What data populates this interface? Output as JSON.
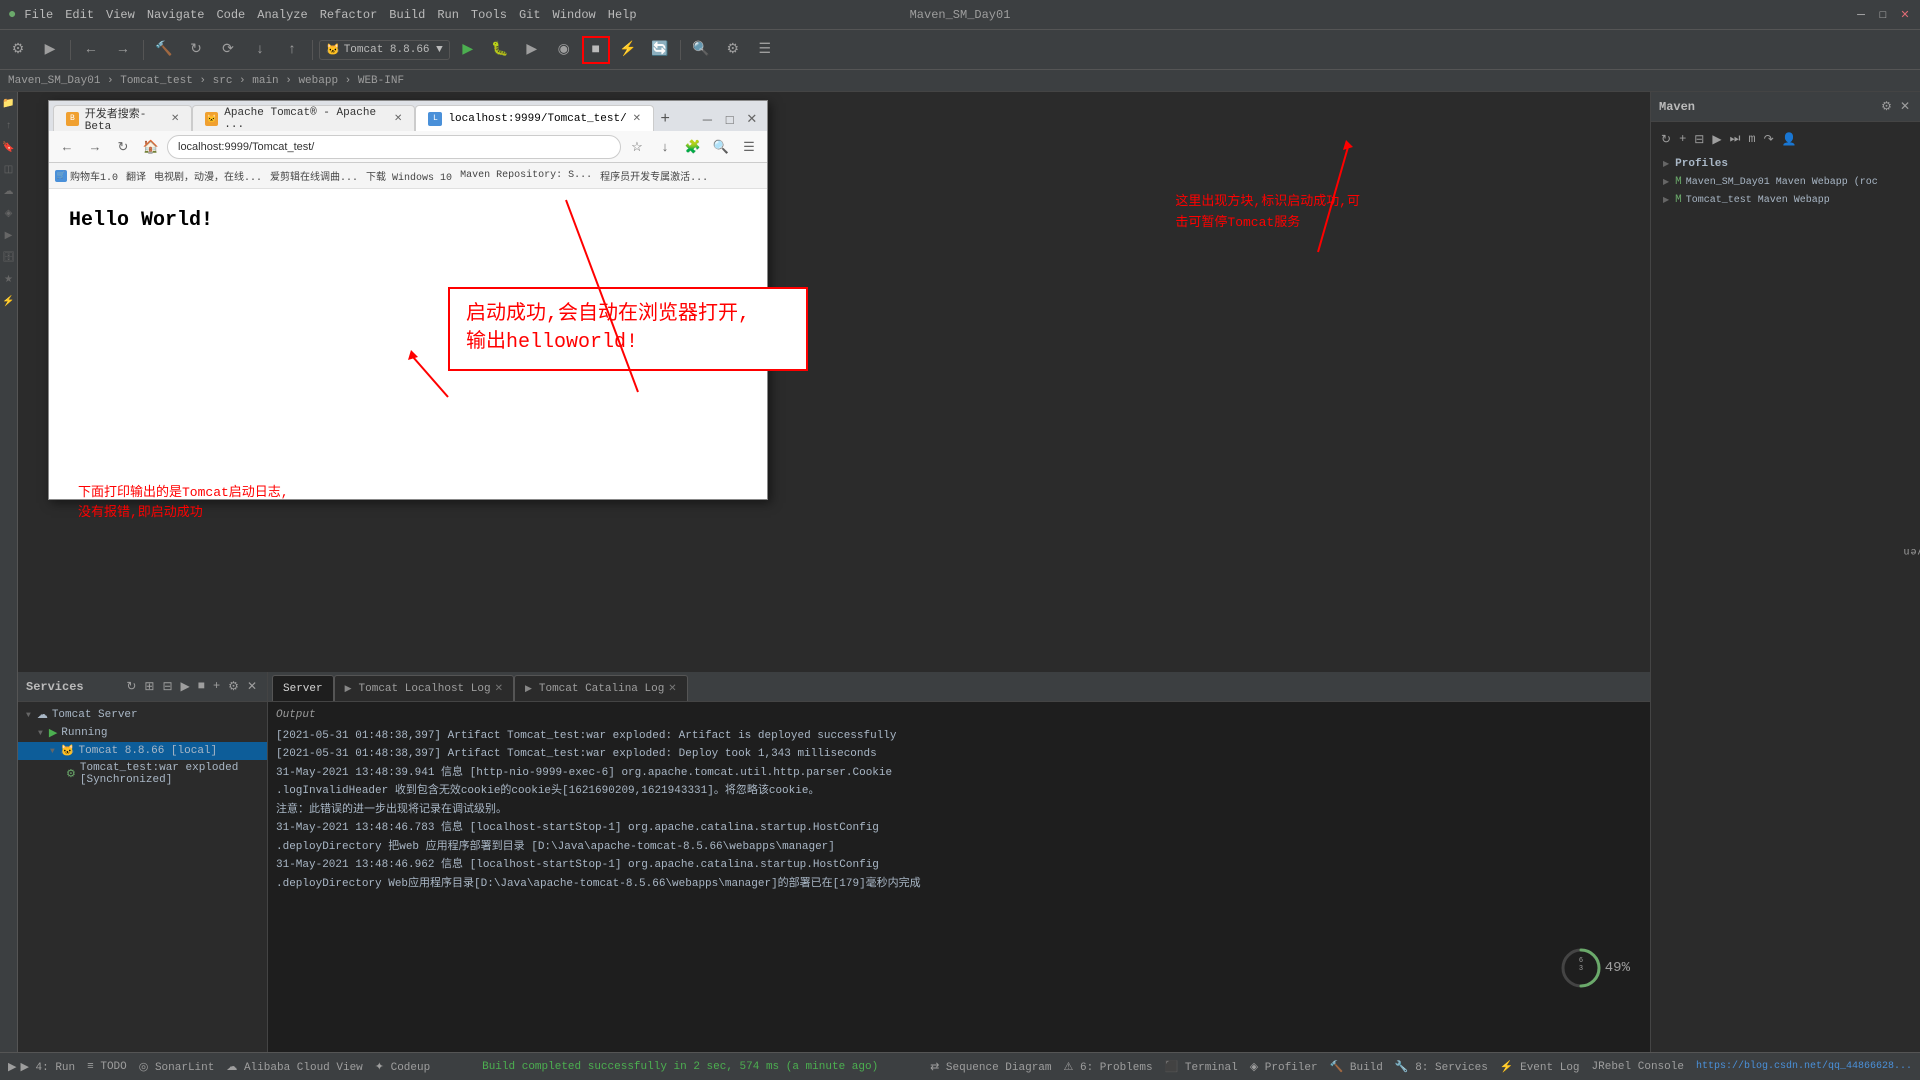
{
  "titlebar": {
    "title": "Maven_SM_Day01",
    "menu_items": [
      "File",
      "Edit",
      "View",
      "Navigate",
      "Code",
      "Analyze",
      "Refactor",
      "Build",
      "Run",
      "Tools",
      "Git",
      "Window",
      "Help"
    ],
    "win_min": "─",
    "win_max": "□",
    "win_close": "✕"
  },
  "breadcrumb": {
    "path": "Maven_SM_Day01 › Tomcat_test › src › main › webapp › WEB-INF"
  },
  "toolbar": {
    "tomcat_label": "Tomcat 8.8.66 ▼"
  },
  "browser": {
    "tab1": "开发者搜索-Beta",
    "tab2": "Apache Tomcat® - Apache ...",
    "tab3": "localhost:9999/Tomcat_test/",
    "url": "localhost:9999/Tomcat_test/",
    "bookmarks": [
      "购物车1.0",
      "翻译",
      "电视剧，动漫，在线...",
      "爱剪辑在线调曲...",
      "下载 Windows 10",
      "Maven Repository: S...",
      "程序员开发专属激活..."
    ],
    "hello_world": "Hello World!"
  },
  "annotation1": {
    "line1": "启动成功,会自动在浏览器打开,",
    "line2": "输出helloworld!"
  },
  "annotation2": {
    "line1": "这里出现方块,标识启动成功,可",
    "line2": "击可暂停Tomcat服务"
  },
  "annotation3": {
    "line1": "下面打印输出的是Tomcat启动日志,",
    "line2": "没有报错,即启动成功"
  },
  "maven": {
    "title": "Maven",
    "profiles": "Profiles",
    "project1": "Maven_SM_Day01 Maven Webapp (roc",
    "project2": "Tomcat_test Maven Webapp"
  },
  "services": {
    "title": "Services",
    "items": [
      {
        "label": "Tomcat Server",
        "type": "server"
      },
      {
        "label": "Running",
        "type": "status"
      },
      {
        "label": "Tomcat 8.8.66 [local]",
        "type": "server-instance"
      },
      {
        "label": "Tomcat_test:war exploded [Synchronized]",
        "type": "artifact"
      }
    ]
  },
  "server_tabs": {
    "tab1": "Server",
    "tab2": "Tomcat Localhost Log",
    "tab3": "Tomcat Catalina Log"
  },
  "console": {
    "header": "Output",
    "lines": [
      "[2021-05-31 01:48:38,397] Artifact Tomcat_test:war exploded: Artifact is deployed successfully",
      "[2021-05-31 01:48:38,397] Artifact Tomcat_test:war exploded: Deploy took 1,343 milliseconds",
      "31-May-2021 13:48:39.941 信息 [http-nio-9999-exec-6] org.apache.tomcat.util.http.parser.Cookie",
      ".logInvalidHeader 收到包含无效cookie的cookie头[1621690209,1621943331]。将忽略该cookie。",
      " 注意：此错误的进一步出现将记录在调试级别。",
      "31-May-2021 13:48:46.783 信息 [localhost-startStop-1] org.apache.catalina.startup.HostConfig",
      ".deployDirectory 把web 应用程序部署到目录 [D:\\Java\\apache-tomcat-8.5.66\\webapps\\manager]",
      "31-May-2021 13:48:46.962 信息 [localhost-startStop-1] org.apache.catalina.startup.HostConfig",
      ".deployDirectory Web应用程序目录[D:\\Java\\apache-tomcat-8.5.66\\webapps\\manager]的部署已在[179]毫秒内完成"
    ]
  },
  "status_bar": {
    "build_status": "Build completed successfully in 2 sec, 574 ms (a minute ago)",
    "items_left": [
      "▶ 4: Run",
      "≡ TODO",
      "◎ SonarLint",
      "☁ Alibaba Cloud View",
      "✦ Codeup"
    ],
    "items_right": [
      "⇄ Sequence Diagram",
      "⚠ 6: Problems",
      "⬛ Terminal",
      "◈ Profiler",
      "🔨 Build",
      "🔧 8: Services",
      "⚡ Event Log",
      "JRebel Console"
    ],
    "url_hint": "https://blog.csdn.net/qq_44866628..."
  },
  "progress": {
    "value": 49,
    "label": "49%"
  }
}
